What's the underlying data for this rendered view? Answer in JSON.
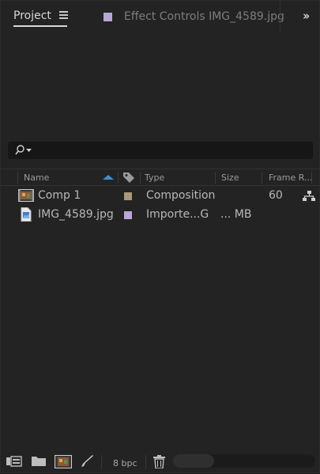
{
  "tabs": {
    "project": "Project",
    "effect_controls": "Effect Controls IMG_4589.jpg"
  },
  "search": {
    "placeholder": "",
    "value": ""
  },
  "columns": {
    "name": "Name",
    "type": "Type",
    "size": "Size",
    "frame_rate": "Frame R..."
  },
  "rows": [
    {
      "name": "Comp 1",
      "label_color": "#a89a78",
      "type": "Composition",
      "size": "",
      "frame_rate": "60",
      "icon": "composition-icon"
    },
    {
      "name": "IMG_4589.jpg",
      "label_color": "#b7a6d6",
      "type": "Importe...G",
      "size": "... MB",
      "frame_rate": "",
      "icon": "image-file-icon"
    }
  ],
  "footer": {
    "bpc": "8 bpc"
  },
  "colors": {
    "accent": "#3f8fd8",
    "tab_swatch": "#b7a6d6"
  }
}
